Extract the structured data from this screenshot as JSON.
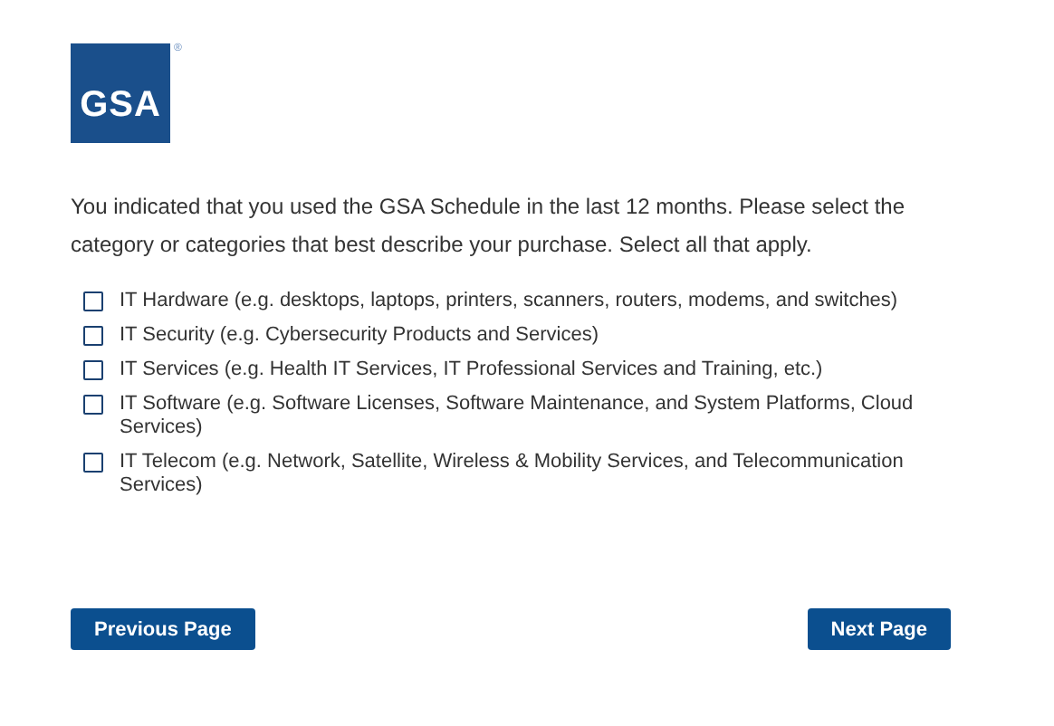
{
  "logo": {
    "text": "GSA",
    "mark": "®"
  },
  "question": "You indicated that you used the GSA Schedule in the last 12 months. Please select the category or categories that best describe your purchase. Select all that apply.",
  "options": [
    {
      "label": "IT Hardware (e.g. desktops, laptops, printers, scanners, routers, modems, and switches)",
      "checked": false
    },
    {
      "label": "IT Security (e.g. Cybersecurity Products and Services)",
      "checked": false
    },
    {
      "label": "IT Services (e.g. Health IT Services, IT Professional Services and Training, etc.)",
      "checked": false
    },
    {
      "label": "IT Software (e.g. Software Licenses, Software Maintenance, and System Platforms, Cloud Services)",
      "checked": false
    },
    {
      "label": "IT Telecom (e.g. Network, Satellite, Wireless & Mobility Services, and Telecommunication Services)",
      "checked": false
    }
  ],
  "buttons": [
    {
      "label": "Previous Page"
    },
    {
      "label": "Next Page"
    }
  ]
}
